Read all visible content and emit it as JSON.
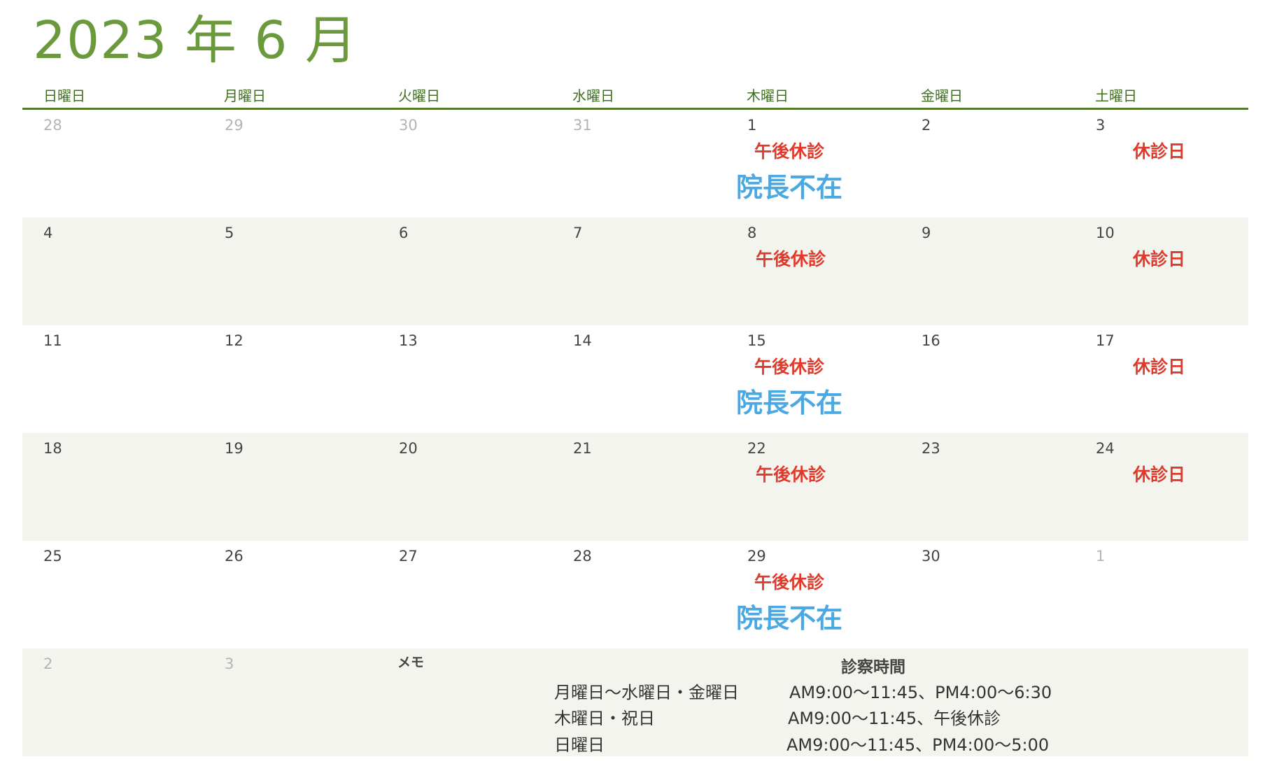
{
  "title": "2023 年 6 月",
  "weekdays": [
    "日曜日",
    "月曜日",
    "火曜日",
    "水曜日",
    "木曜日",
    "金曜日",
    "土曜日"
  ],
  "weeks": [
    [
      "28",
      "29",
      "30",
      "31",
      "1",
      "2",
      "3"
    ],
    [
      "4",
      "5",
      "6",
      "7",
      "8",
      "9",
      "10"
    ],
    [
      "11",
      "12",
      "13",
      "14",
      "15",
      "16",
      "17"
    ],
    [
      "18",
      "19",
      "20",
      "21",
      "22",
      "23",
      "24"
    ],
    [
      "25",
      "26",
      "27",
      "28",
      "29",
      "30",
      "1"
    ],
    [
      "2",
      "3",
      "",
      "",
      "",
      "",
      ""
    ]
  ],
  "other_month": [
    [
      true,
      true,
      true,
      true,
      false,
      false,
      false
    ],
    [
      false,
      false,
      false,
      false,
      false,
      false,
      false
    ],
    [
      false,
      false,
      false,
      false,
      false,
      false,
      false
    ],
    [
      false,
      false,
      false,
      false,
      false,
      false,
      false
    ],
    [
      false,
      false,
      false,
      false,
      false,
      false,
      true
    ],
    [
      true,
      true,
      false,
      false,
      false,
      false,
      false
    ]
  ],
  "events": {
    "afternoon_closed": "午後休診",
    "closed_day": "休診日",
    "director_absent": "院長不在"
  },
  "memo": {
    "label": "メモ",
    "hours_title": "診察時間",
    "rows": [
      {
        "days": "月曜日～水曜日・金曜日",
        "time": "AM9:00～11:45、PM4:00～6:30"
      },
      {
        "days": "木曜日・祝日",
        "time": "AM9:00～11:45、午後休診"
      },
      {
        "days": "日曜日",
        "time": "AM9:00～11:45、PM4:00～5:00"
      }
    ]
  },
  "colors": {
    "title": "#6a9a3c",
    "weekday_text": "#3f6f1e",
    "header_rule": "#557a2c",
    "row_shade": "#f4f4ef",
    "event_red": "#e03a2c",
    "event_blue": "#4aa8e2",
    "other_month_text": "#b4b4b4"
  }
}
